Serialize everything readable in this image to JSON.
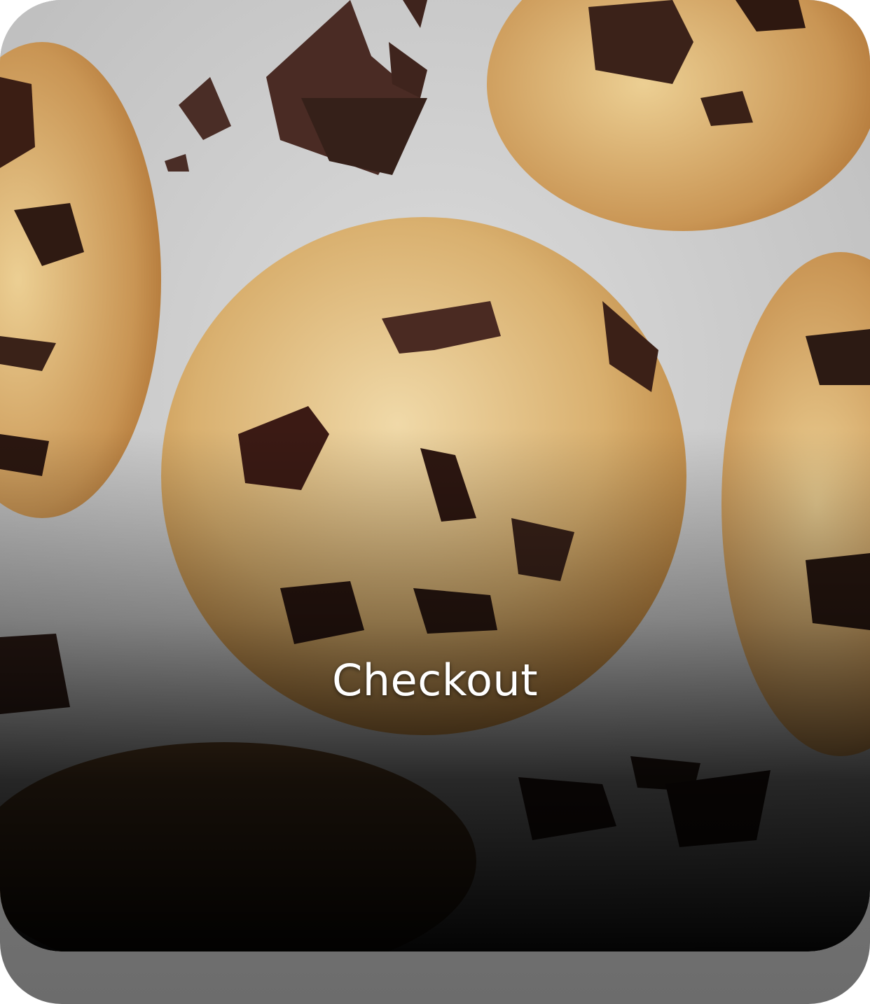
{
  "card": {
    "title": "Checkout",
    "image_icon": "cookie-photo",
    "accent_overlay": "#000000",
    "shadow_color": "#7a7a7a"
  }
}
